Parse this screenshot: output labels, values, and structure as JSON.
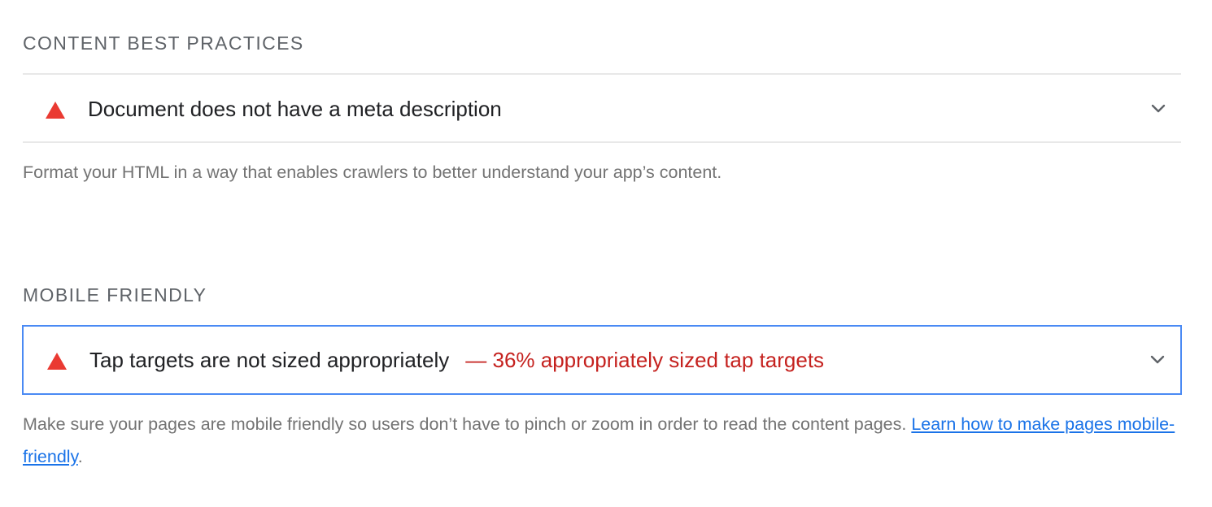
{
  "groups": [
    {
      "title": "CONTENT BEST PRACTICES",
      "audits": [
        {
          "icon": "warning-triangle-icon",
          "title": "Document does not have a meta description",
          "display_value": ""
        }
      ],
      "description": "Format your HTML in a way that enables crawlers to better understand your app’s content."
    },
    {
      "title": "MOBILE FRIENDLY",
      "audits": [
        {
          "icon": "warning-triangle-icon",
          "title": "Tap targets are not sized appropriately",
          "display_value": "— 36% appropriately sized tap targets"
        }
      ],
      "description": "Make sure your pages are mobile friendly so users don’t have to pinch or zoom in order to read the content pages. ",
      "link_text": "Learn how to make pages mobile-friendly",
      "link_suffix": "."
    }
  ],
  "colors": {
    "fail": "#ea3a32",
    "fail_text": "#c5221f",
    "link": "#1a73e8",
    "focus_border": "#4a8af4"
  }
}
